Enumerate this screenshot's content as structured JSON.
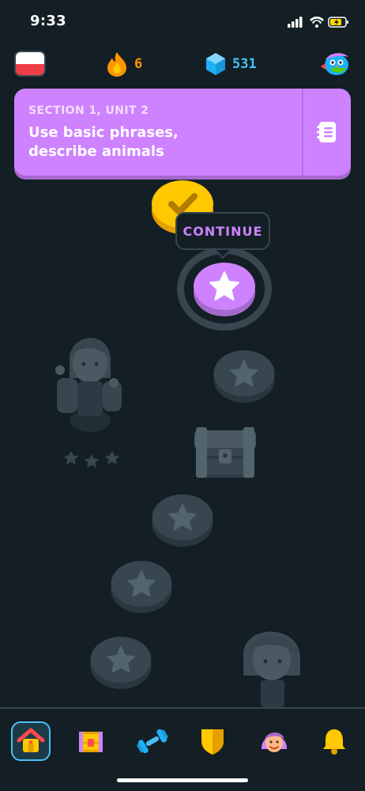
{
  "status_bar": {
    "time": "9:33"
  },
  "stats": {
    "language_flag": "flag-poland-icon",
    "streak": "6",
    "gems": "531"
  },
  "unit": {
    "section": "SECTION 1, UNIT 2",
    "title_line1": "Use basic phrases,",
    "title_line2": "describe animals",
    "color": "#ce82ff"
  },
  "path": {
    "tooltip_label": "CONTINUE",
    "nodes": [
      {
        "type": "completed",
        "icon": "check-icon"
      },
      {
        "type": "current",
        "icon": "star-icon"
      },
      {
        "type": "locked",
        "icon": "star-icon"
      },
      {
        "type": "chest",
        "icon": "chest-icon"
      },
      {
        "type": "locked",
        "icon": "star-icon"
      },
      {
        "type": "locked",
        "icon": "star-icon"
      },
      {
        "type": "locked",
        "icon": "star-icon"
      }
    ]
  },
  "nav": [
    {
      "name": "learn",
      "icon": "home-icon",
      "active": true
    },
    {
      "name": "leaderboards",
      "icon": "treasure-icon",
      "active": false
    },
    {
      "name": "practice",
      "icon": "dumbbell-icon",
      "active": false
    },
    {
      "name": "leagues",
      "icon": "shield-icon",
      "active": false
    },
    {
      "name": "profile",
      "icon": "avatar-icon",
      "active": false
    },
    {
      "name": "notifications",
      "icon": "bell-icon",
      "active": false
    }
  ],
  "colors": {
    "background": "#131f24",
    "accent": "#ce82ff",
    "streak": "#ff9600",
    "gems": "#49c0f8",
    "locked": "#37464f"
  }
}
